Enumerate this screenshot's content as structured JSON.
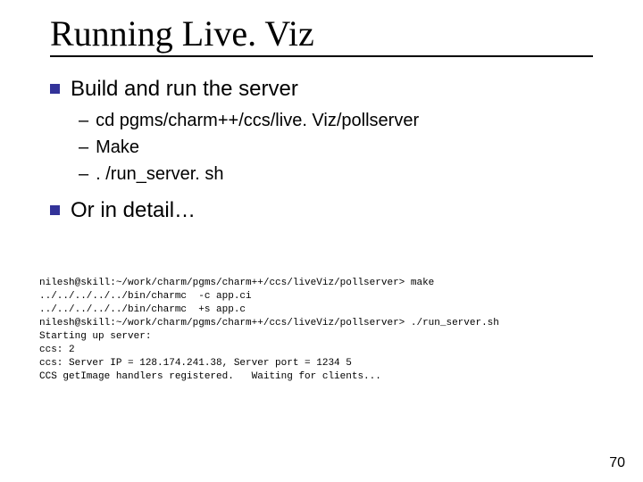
{
  "title": "Running Live. Viz",
  "bullets": {
    "b1": "Build and run the server",
    "subs": {
      "s1": "cd pgms/charm++/ccs/live. Viz/pollserver",
      "s2": "Make",
      "s3": ". /run_server. sh"
    },
    "b2": "Or in detail…"
  },
  "terminal": {
    "l1": "nilesh@skill:~/work/charm/pgms/charm++/ccs/liveViz/pollserver> make",
    "l2": "../../../../../bin/charmc  -c app.ci",
    "l3": "../../../../../bin/charmc  +s app.c",
    "l4": "nilesh@skill:~/work/charm/pgms/charm++/ccs/liveViz/pollserver> ./run_server.sh",
    "l5": "Starting up server:",
    "l6": "ccs: 2",
    "l7": "ccs: Server IP = 128.174.241.38, Server port = 1234 5",
    "l8": "CCS getImage handlers registered.   Waiting for clients..."
  },
  "page_number": "70"
}
